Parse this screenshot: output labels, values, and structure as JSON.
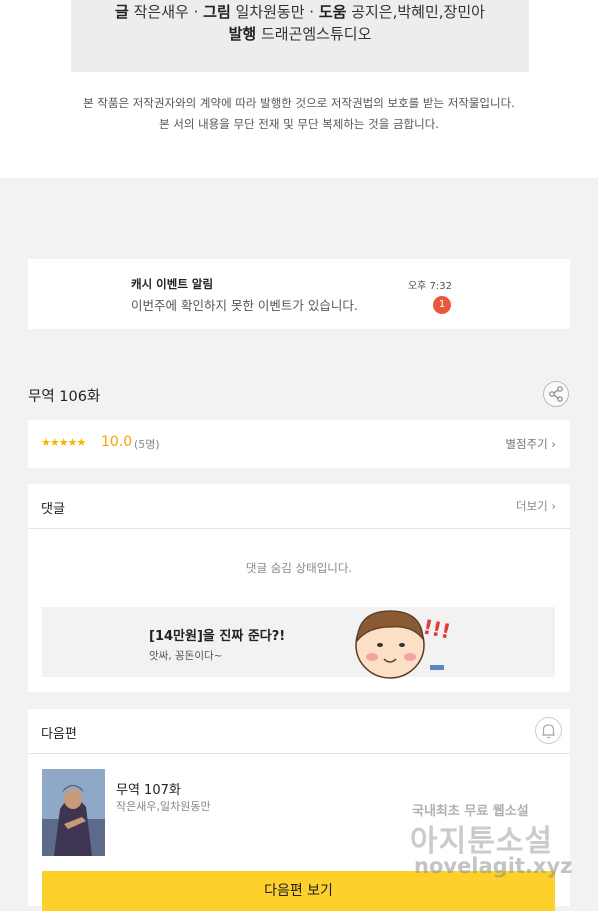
{
  "credits": {
    "line1_label1": "글",
    "line1_value1": " 작은새우 · ",
    "line1_label2": "그림",
    "line1_value2": " 일차원동만 · ",
    "line1_label3": "도움",
    "line1_value3": " 공지은,박혜민,장민아",
    "line2_label": "발행",
    "line2_value": " 드래곤엠스튜디오"
  },
  "copyright": {
    "line1": "본 작품은 저작권자와의 계약에 따라 발행한 것으로 저작권법의 보호를 받는 저작물입니다.",
    "line2": "본 서의 내용을 무단 전재 및 무단 복제하는 것을 금합니다."
  },
  "notification": {
    "title": "캐시 이벤트 알림",
    "text": "이번주에 확인하지 못한 이벤트가 있습니다.",
    "time": "오후 7:32",
    "badge": "1"
  },
  "episode": {
    "title": "무역 106화"
  },
  "rating": {
    "stars": "★★★★★",
    "value": "10.0",
    "count": "(5명)",
    "rate_link": "별점주기 ›"
  },
  "comments": {
    "title": "댓글",
    "more": "더보기 ›",
    "hidden_message": "댓글 숨김 상태입니다.",
    "banner_title": "[14만원]을 진짜 준다?!",
    "banner_subtitle": "앗싸, 꽁돈이다~"
  },
  "next": {
    "header": "다음편",
    "episode_title": "무역 107화",
    "authors": "작은새우,일차원동만",
    "button_label": "다음편 보기"
  },
  "watermark": {
    "line1": "국내최초 무료 웹소설",
    "line2": "아지툰소설",
    "line3": "novelagit.xyz"
  },
  "colors": {
    "accent_yellow": "#fdd02c",
    "star": "#f2b705",
    "badge_red": "#e8593c"
  }
}
